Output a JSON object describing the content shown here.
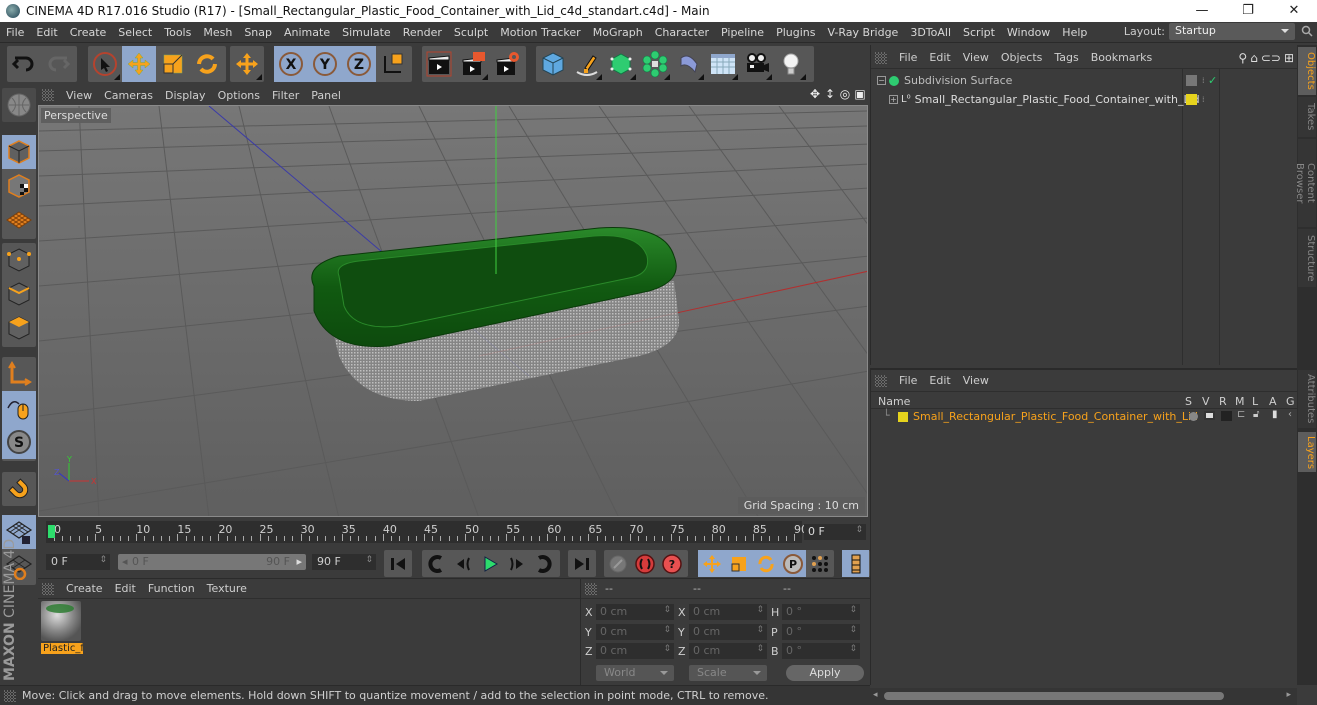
{
  "window": {
    "title": "CINEMA 4D R17.016 Studio (R17) - [Small_Rectangular_Plastic_Food_Container_with_Lid_c4d_standart.c4d] - Main",
    "controls": {
      "minimize": "—",
      "restore": "❐",
      "close": "✕"
    }
  },
  "menubar": {
    "items": [
      "File",
      "Edit",
      "Create",
      "Select",
      "Tools",
      "Mesh",
      "Snap",
      "Animate",
      "Simulate",
      "Render",
      "Sculpt",
      "Motion Tracker",
      "MoGraph",
      "Character",
      "Pipeline",
      "Plugins",
      "V-Ray Bridge",
      "3DToAll",
      "Script",
      "Window",
      "Help"
    ],
    "layout_label": "Layout:",
    "layout_value": "Startup"
  },
  "toolbar": {
    "groups": [
      [
        "undo-icon",
        "redo-icon"
      ],
      [
        "live-selection-icon",
        "move-icon",
        "scale-icon",
        "rotate-icon"
      ],
      [
        "move-recent-icon"
      ],
      [
        "x-axis-icon",
        "y-axis-icon",
        "z-axis-icon",
        "coordinate-system-icon"
      ],
      [
        "render-view-icon",
        "render-picture-viewer-icon",
        "render-settings-icon"
      ],
      [
        "cube-icon",
        "pen-spline-icon",
        "subdivision-icon",
        "cloner-icon",
        "deformer-icon",
        "floor-icon",
        "camera-icon",
        "light-icon"
      ]
    ]
  },
  "viewport": {
    "menu": [
      "View",
      "Cameras",
      "Display",
      "Options",
      "Filter",
      "Panel"
    ],
    "label": "Perspective",
    "grid_spacing": "Grid Spacing : 10 cm",
    "icons": [
      "pan-icon",
      "dolly-icon",
      "orbit-icon",
      "maximize-icon"
    ]
  },
  "left_tools": [
    "make-editable-icon",
    "model-mode-icon",
    "texture-mode-icon",
    "workplane-icon",
    "points-mode-icon",
    "edges-mode-icon",
    "polygons-mode-icon",
    "axis-icon",
    "tweak-icon",
    "snap-icon",
    "magnet-icon",
    "lock-workplane-icon",
    "planar-workplane-icon"
  ],
  "timeline": {
    "ticks": [
      "0",
      "5",
      "10",
      "15",
      "20",
      "25",
      "30",
      "35",
      "40",
      "45",
      "50",
      "55",
      "60",
      "65",
      "70",
      "75",
      "80",
      "85",
      "90"
    ],
    "current_frame": "0 F",
    "start_field": "0 F",
    "range_start": "0 F",
    "range_end": "90 F",
    "end_field": "90 F",
    "current_frame_value": 0,
    "max_frame": 90
  },
  "transport": {
    "buttons": [
      "go-to-start-icon",
      "prev-key-icon",
      "prev-frame-icon",
      "play-icon",
      "next-frame-icon",
      "next-key-icon",
      "go-to-end-icon",
      "record-disabled-icon",
      "autokey-icon",
      "keyframe-selection-icon",
      "key-position-icon",
      "key-scale-icon",
      "key-rotation-icon",
      "key-param-icon",
      "key-pla-icon",
      "timeline-icon"
    ]
  },
  "material_manager": {
    "menu": [
      "Create",
      "Edit",
      "Function",
      "Texture"
    ],
    "materials": [
      {
        "name": "Plastic_f"
      }
    ]
  },
  "brand": {
    "maxon": "MAXON",
    "product": "CINEMA 4D"
  },
  "coordinates": {
    "headers": [
      "--",
      "--",
      "--"
    ],
    "rows": [
      {
        "a1": "X",
        "v1": "0 cm",
        "a2": "X",
        "v2": "0 cm",
        "a3": "H",
        "v3": "0 °"
      },
      {
        "a1": "Y",
        "v1": "0 cm",
        "a2": "Y",
        "v2": "0 cm",
        "a3": "P",
        "v3": "0 °"
      },
      {
        "a1": "Z",
        "v1": "0 cm",
        "a2": "Z",
        "v2": "0 cm",
        "a3": "B",
        "v3": "0 °"
      }
    ],
    "space_select": "World",
    "mode_select": "Scale",
    "apply_label": "Apply"
  },
  "status": "Move: Click and drag to move elements. Hold down SHIFT to quantize movement / add to the selection in point mode, CTRL to remove.",
  "object_manager": {
    "menu": [
      "File",
      "Edit",
      "View",
      "Objects",
      "Tags",
      "Bookmarks"
    ],
    "objects": [
      {
        "name": "Subdivision Surface",
        "expand": "−",
        "color": "#2ecc71"
      },
      {
        "name": "Small_Rectangular_Plastic_Food_Container_with_Lid",
        "expand": "+",
        "layer_color": "#e6d31d"
      }
    ]
  },
  "layer_manager": {
    "menu": [
      "File",
      "Edit",
      "View"
    ],
    "columns": [
      "Name",
      "S",
      "V",
      "R",
      "M",
      "L",
      "A",
      "G"
    ],
    "layers": [
      {
        "name": "Small_Rectangular_Plastic_Food_Container_with_Lid",
        "color": "#e6d31d"
      }
    ]
  },
  "side_tabs": {
    "top": [
      "Objects",
      "Takes",
      "Content Browser",
      "Structure"
    ],
    "bottom": [
      "Attributes",
      "Layers"
    ],
    "active": [
      "Objects",
      "Layers"
    ]
  },
  "colors": {
    "accent_orange": "#f7a21c",
    "active_blue": "#8fa7cc",
    "lid_green": "#1e6b1e"
  }
}
